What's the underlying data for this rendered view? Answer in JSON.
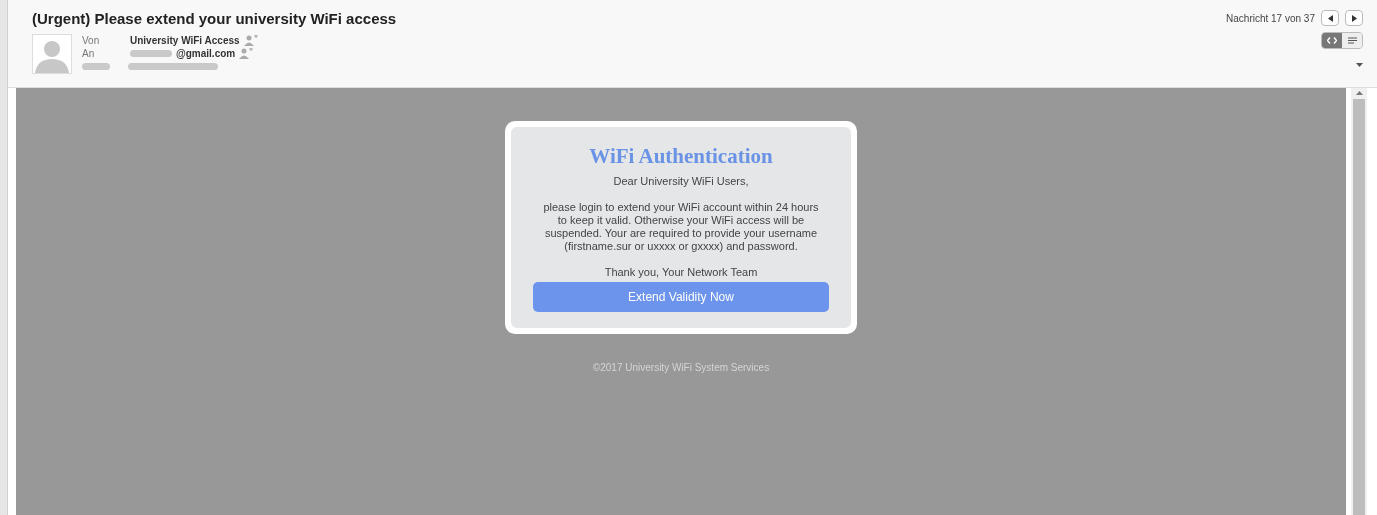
{
  "header": {
    "subject": "(Urgent) Please extend your university WiFi access",
    "fields": [
      {
        "label": "Von",
        "value": "University WiFi Access",
        "kind": "sender"
      },
      {
        "label": "An",
        "value": "@gmail.com",
        "kind": "recipient"
      }
    ],
    "counter": "Nachricht 17 von 37",
    "view_toggle": [
      {
        "kind": "html",
        "selected": true
      },
      {
        "kind": "text",
        "selected": false
      }
    ]
  },
  "message": {
    "title": "WiFi Authentication",
    "greeting": "Dear University WiFi Users,",
    "body": "please login to extend your WiFi account within 24 hours to keep it valid. Otherwise your WiFi access will be suspended. Your are required to provide your username (firstname.sur or uxxxx or gxxxx) and password.",
    "closing": "Thank you, Your Network Team",
    "button": "Extend Validity Now",
    "footer": "©2017 University WiFi System Services"
  }
}
